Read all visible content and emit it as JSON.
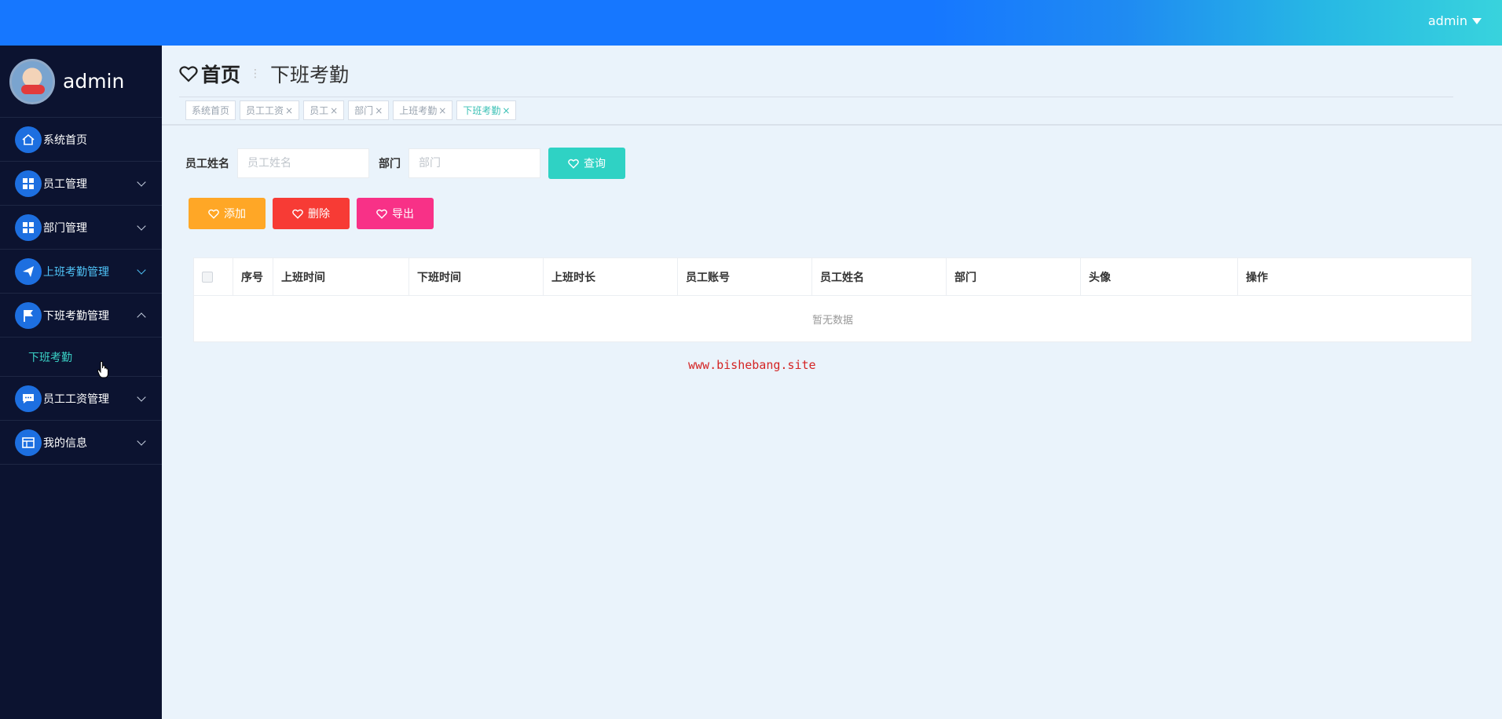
{
  "topbar": {
    "user": "admin"
  },
  "sidebar": {
    "username": "admin",
    "items": [
      {
        "label": "系统首页",
        "icon": "home-icon",
        "expandable": false
      },
      {
        "label": "员工管理",
        "icon": "grid-icon",
        "expandable": true
      },
      {
        "label": "部门管理",
        "icon": "grid-icon",
        "expandable": true
      },
      {
        "label": "上班考勤管理",
        "icon": "send-icon",
        "expandable": true
      },
      {
        "label": "下班考勤管理",
        "icon": "flag-icon",
        "expandable": true,
        "expanded": true
      },
      {
        "label": "员工工资管理",
        "icon": "chat-icon",
        "expandable": true
      },
      {
        "label": "我的信息",
        "icon": "card-icon",
        "expandable": true
      }
    ],
    "submenu": {
      "label": "下班考勤"
    }
  },
  "breadcrumb": {
    "home": "首页",
    "current": "下班考勤"
  },
  "tabs": [
    {
      "label": "系统首页",
      "closable": false
    },
    {
      "label": "员工工资",
      "closable": true
    },
    {
      "label": "员工",
      "closable": true
    },
    {
      "label": "部门",
      "closable": true
    },
    {
      "label": "上班考勤",
      "closable": true
    },
    {
      "label": "下班考勤",
      "closable": true,
      "active": true
    }
  ],
  "search": {
    "name_label": "员工姓名",
    "name_placeholder": "员工姓名",
    "dept_label": "部门",
    "dept_placeholder": "部门",
    "query_label": "查询"
  },
  "actions": {
    "add": "添加",
    "delete": "删除",
    "export": "导出"
  },
  "table": {
    "columns": [
      "序号",
      "上班时间",
      "下班时间",
      "上班时长",
      "员工账号",
      "员工姓名",
      "部门",
      "头像",
      "操作"
    ],
    "empty_text": "暂无数据"
  },
  "watermark": "www.bishebang.site",
  "colors": {
    "topbar": "#1677ff",
    "sidebar": "#0c1330",
    "query": "#2fd2c4",
    "add": "#ffa726",
    "delete": "#f73b35",
    "export": "#f83187"
  }
}
